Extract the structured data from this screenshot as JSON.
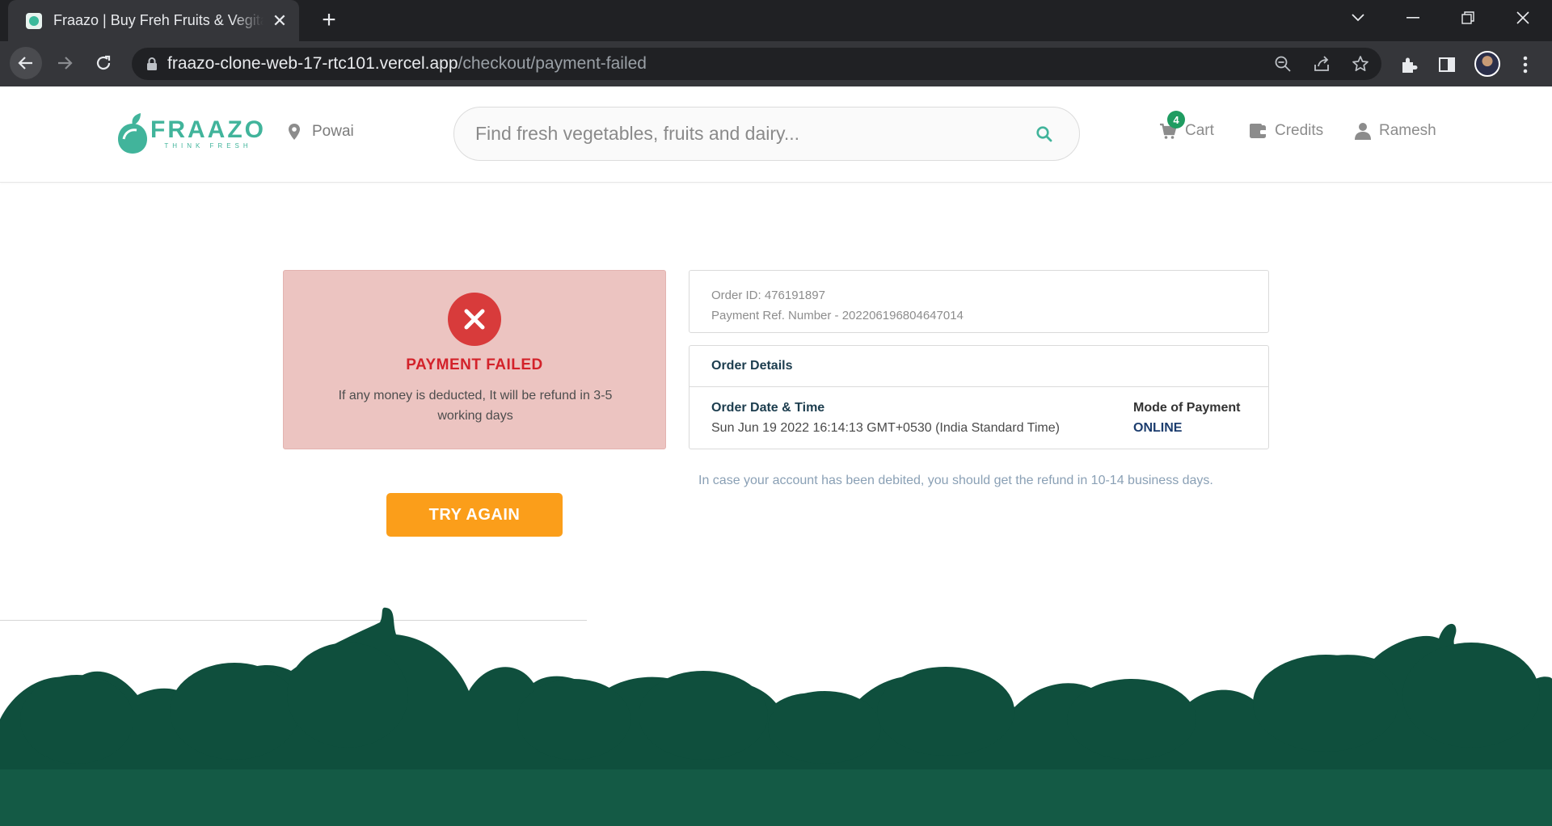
{
  "browser": {
    "tab_title": "Fraazo | Buy Freh Fruits & Vegitables",
    "url_host": "fraazo-clone-web-17-rtc101.vercel.app",
    "url_path": "/checkout/payment-failed"
  },
  "header": {
    "logo_text": "FRAAZO",
    "logo_tagline": "THINK FRESH",
    "location": "Powai",
    "search_placeholder": "Find fresh vegetables, fruits and dairy...",
    "cart_label": "Cart",
    "cart_count": "4",
    "credits_label": "Credits",
    "user_name": "Ramesh"
  },
  "payment_status": {
    "title": "PAYMENT FAILED",
    "message": "If any money is deducted, It will be refund in 3-5 working days",
    "try_again_label": "TRY AGAIN"
  },
  "order": {
    "order_id": "Order ID: 476191897",
    "payment_ref": "Payment Ref. Number - 202206196804647014",
    "details_heading": "Order Details",
    "date_label": "Order Date & Time",
    "date_value": "Sun Jun 19 2022 16:14:13 GMT+0530 (India Standard Time)",
    "mode_label": "Mode of Payment",
    "mode_value": "ONLINE",
    "refund_note": "In case your account has been debited, you should get the refund in 10-14 business days."
  },
  "colors": {
    "brand": "#41b49b",
    "failure_bg": "#ecc4c1",
    "failure_text": "#d3222a",
    "button": "#fb9e1a",
    "footer_green": "#0f4f3d"
  }
}
